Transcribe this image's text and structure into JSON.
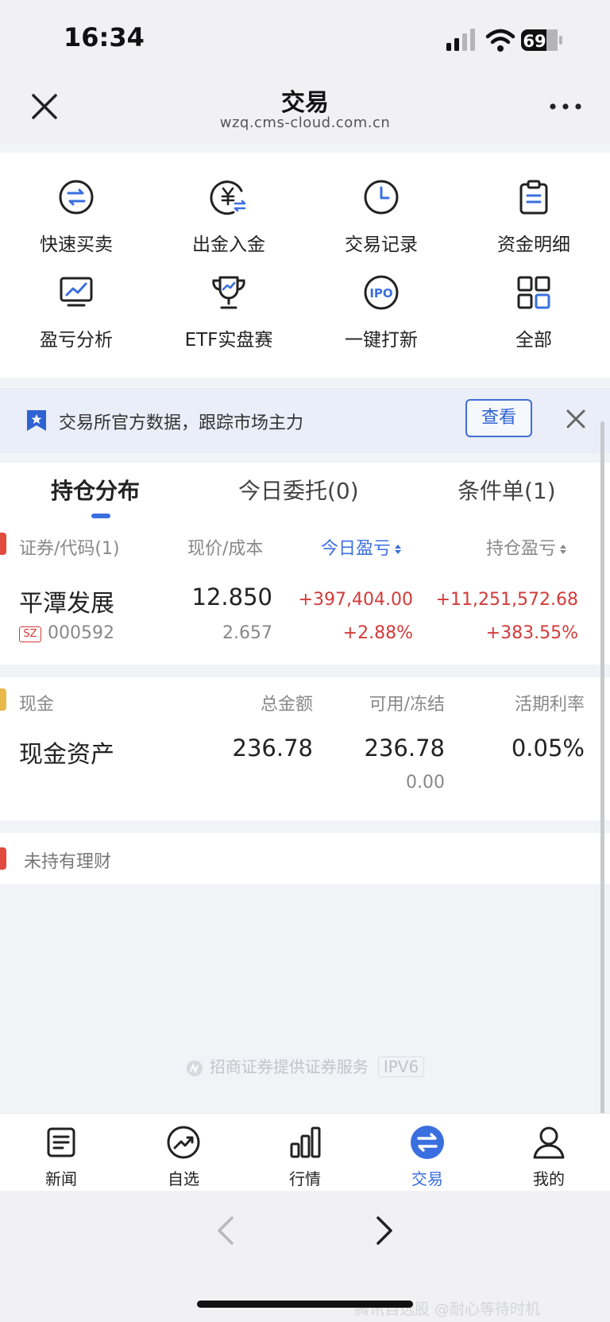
{
  "status_bar": {
    "time": "16:34",
    "battery": "69"
  },
  "nav": {
    "title": "交易",
    "url": "wzq.cms-cloud.com.cn"
  },
  "quick_actions": [
    {
      "label": "快速买卖",
      "icon": "exchange-circle-icon"
    },
    {
      "label": "出金入金",
      "icon": "yuan-transfer-icon"
    },
    {
      "label": "交易记录",
      "icon": "clock-icon"
    },
    {
      "label": "资金明细",
      "icon": "clipboard-icon"
    },
    {
      "label": "盈亏分析",
      "icon": "chart-monitor-icon"
    },
    {
      "label": "ETF实盘赛",
      "icon": "trophy-icon"
    },
    {
      "label": "一键打新",
      "icon": "ipo-icon"
    },
    {
      "label": "全部",
      "icon": "grid-icon"
    }
  ],
  "banner": {
    "text": "交易所官方数据，跟踪市场主力",
    "button": "查看"
  },
  "tabs": [
    "持仓分布",
    "今日委托(0)",
    "条件单(1)"
  ],
  "holdings": {
    "headers": [
      "证券/代码(1)",
      "现价/成本",
      "今日盈亏",
      "持仓盈亏"
    ],
    "rows": [
      {
        "name": "平潭发展",
        "market": "SZ",
        "code": "000592",
        "price": "12.850",
        "cost": "2.657",
        "today_pl": "+397,404.00",
        "today_pct": "+2.88%",
        "total_pl": "+11,251,572.68",
        "total_pct": "+383.55%"
      }
    ]
  },
  "cash": {
    "headers": [
      "现金",
      "总金额",
      "可用/冻结",
      "活期利率"
    ],
    "row": {
      "name": "现金资产",
      "total": "236.78",
      "available": "236.78",
      "frozen": "0.00",
      "rate": "0.05%"
    }
  },
  "wealth": {
    "text": "未持有理财"
  },
  "footer_note": {
    "text": "招商证券提供证券服务",
    "badge": "IPV6"
  },
  "tabbar": [
    {
      "label": "新闻",
      "icon": "news-icon"
    },
    {
      "label": "自选",
      "icon": "trend-circle-icon"
    },
    {
      "label": "行情",
      "icon": "bar-chart-icon"
    },
    {
      "label": "交易",
      "icon": "trade-exchange-icon",
      "active": true
    },
    {
      "label": "我的",
      "icon": "person-icon"
    }
  ],
  "watermark": "腾讯自选股 @耐心等待时机",
  "colors": {
    "accent": "#3a6fe0",
    "up_red": "#d43a3a"
  }
}
